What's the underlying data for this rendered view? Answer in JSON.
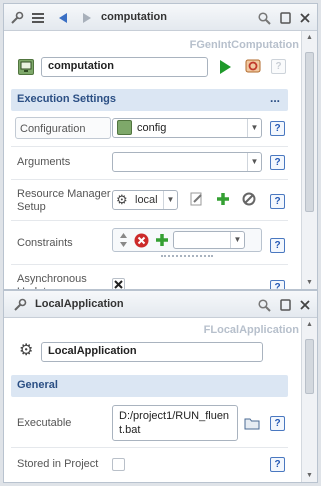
{
  "colors": {
    "accent_blue": "#2358b4",
    "section_bg": "#dbe6f3",
    "play_green": "#1f9a2b",
    "delete_red": "#cc2a2a"
  },
  "top_panel": {
    "toolbar": {
      "title": "computation",
      "icons": [
        "tools-icon",
        "list-icon",
        "back-arrow-icon",
        "forward-arrow-icon",
        "search-icon",
        "restore-icon",
        "close-icon"
      ]
    },
    "kind_label": "FGenIntComputation",
    "name_value": "computation",
    "help_label": "?",
    "section": {
      "title": "Execution Settings",
      "more": "..."
    },
    "rows": {
      "configuration": {
        "label": "Configuration",
        "value": "config"
      },
      "arguments": {
        "label": "Arguments",
        "value": ""
      },
      "resource_manager": {
        "label": "Resource Manager Setup",
        "value": "local"
      },
      "constraints": {
        "label": "Constraints",
        "value": ""
      },
      "async": {
        "label": "Asynchronous Update"
      }
    }
  },
  "bottom_panel": {
    "toolbar": {
      "title": "LocalApplication",
      "icons": [
        "tools-icon",
        "search-icon",
        "restore-icon",
        "close-icon"
      ]
    },
    "kind_label": "FLocalApplication",
    "name_value": "LocalApplication",
    "section": {
      "title": "General"
    },
    "rows": {
      "executable": {
        "label": "Executable",
        "value": "D:/project1/RUN_fluent.bat"
      },
      "stored": {
        "label": "Stored in Project"
      }
    }
  }
}
